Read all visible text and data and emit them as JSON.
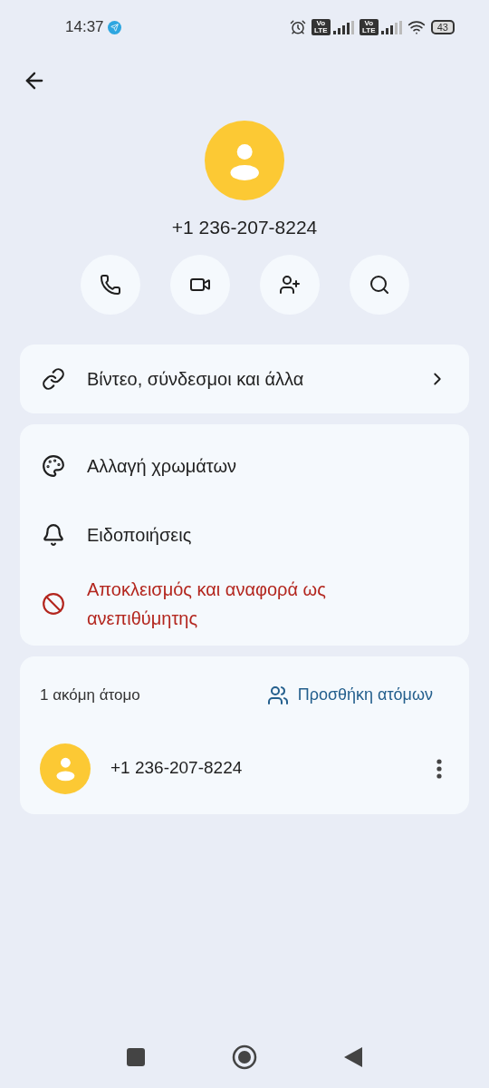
{
  "status_bar": {
    "time": "14:37",
    "battery": "43",
    "network_badges": [
      "Vo LTE",
      "Vo LTE"
    ]
  },
  "contact": {
    "phone": "+1 236-207-8224"
  },
  "media_row": {
    "label": "Βίντεο, σύνδεσμοι και άλλα"
  },
  "options": [
    {
      "label": "Αλλαγή χρωμάτων",
      "kind": "normal"
    },
    {
      "label": "Ειδοποιήσεις",
      "kind": "normal"
    },
    {
      "label": "Αποκλεισμός και αναφορά ως ανεπιθύμητης",
      "kind": "danger"
    }
  ],
  "people": {
    "count_label": "1 ακόμη άτομο",
    "add_button": "Προσθήκη ατόμων",
    "members": [
      {
        "phone": "+1 236-207-8224"
      }
    ]
  }
}
